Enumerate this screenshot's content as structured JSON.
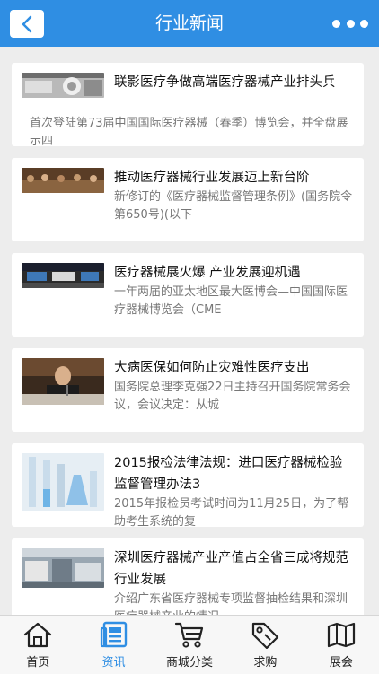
{
  "header": {
    "title": "行业新闻",
    "back_icon": "chevron-left-icon",
    "more_icon": "more-dots-icon"
  },
  "articles": [
    {
      "title": "联影医疗争做高端医疗器械产业排头兵",
      "desc": "首次登陆第73届中国国际医疗器械（春季）博览会，并全盘展示四",
      "image": "medical-scanner-photo"
    },
    {
      "title": "推动医疗器械行业发展迈上新台阶",
      "desc": "新修订的《医疗器械监督管理条例》(国务院令第650号)(以下",
      "image": "conference-photo"
    },
    {
      "title": "医疗器械展火爆 产业发展迎机遇",
      "desc": "一年两届的亚太地区最大医博会—中国国际医疗器械博览会（CME",
      "image": "expo-hall-photo"
    },
    {
      "title": "大病医保如何防止灾难性医疗支出",
      "desc": "国务院总理李克强22日主持召开国务院常务会议，会议决定：从城",
      "image": "meeting-speaker-photo"
    },
    {
      "title": "2015报检法律法规：进口医疗器械检验监督管理办法3",
      "desc": "2015年报检员考试时间为11月25日，为了帮助考生系统的复",
      "image": "lab-glassware-photo"
    },
    {
      "title": "深圳医疗器械产业产值占全省三成将规范行业发展",
      "desc": "介绍广东省医疗器械专项监督抽检结果和深圳医疗器械产业的情况",
      "image": "lab-equipment-photo"
    }
  ],
  "tabbar": {
    "active": "资讯",
    "accent_color": "#2f8ee3",
    "tabs": [
      {
        "label": "首页",
        "icon": "home-icon"
      },
      {
        "label": "资讯",
        "icon": "news-icon"
      },
      {
        "label": "商城分类",
        "icon": "cart-icon"
      },
      {
        "label": "求购",
        "icon": "tag-icon"
      },
      {
        "label": "展会",
        "icon": "map-icon"
      }
    ]
  }
}
